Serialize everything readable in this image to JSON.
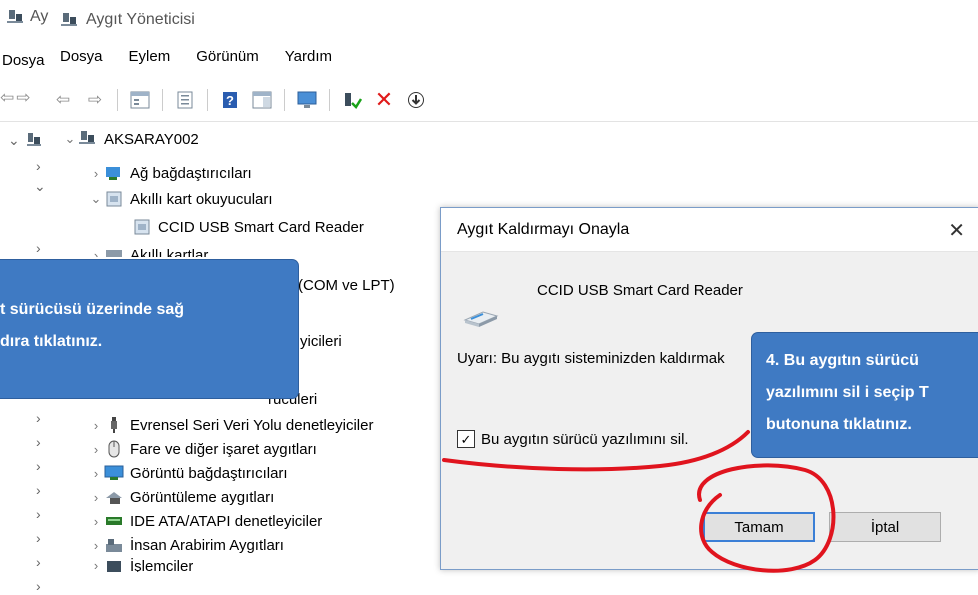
{
  "back_window": {
    "title_fragment": "Ay",
    "menu_fragment": "Dosya"
  },
  "window": {
    "title": "Aygıt Yöneticisi",
    "menu": [
      "Dosya",
      "Eylem",
      "Görünüm",
      "Yardım"
    ]
  },
  "tree": {
    "root": "AKSARAY002",
    "items": [
      "Ağ bağdaştırıcıları",
      "Akıllı kart okuyucuları",
      "CCID USB Smart Card Reader",
      "Akıllı kartlar",
      "(COM ve LPT)",
      "yicileri",
      "rücüleri",
      "Evrensel Seri Veri Yolu denetleyiciler",
      "Fare ve diğer işaret aygıtları",
      "Görüntü bağdaştırıcıları",
      "Görüntüleme aygıtları",
      "IDE ATA/ATAPI denetleyiciler",
      "İnsan Arabirim Aygıtları",
      "İşlemciler"
    ]
  },
  "dialog": {
    "title": "Aygıt Kaldırmayı Onayla",
    "device_name": "CCID USB Smart Card Reader",
    "warning": "Uyarı: Bu aygıtı sisteminizden kaldırmak",
    "checkbox_label": "Bu aygıtın sürücü yazılımını sil.",
    "checkbox_checked": true,
    "ok_label": "Tamam",
    "cancel_label": "İptal"
  },
  "callouts": {
    "left_line1": "t sürücüsü üzerinde sağ",
    "left_line2": "dıra tıklatınız.",
    "right_line1": "4. Bu aygıtın sürücü",
    "right_line2": "yazılımını sil i seçip T",
    "right_line3": "butonuna tıklatınız."
  },
  "colors": {
    "callout_bg": "#3f7ac3",
    "annotation_red": "#e0141e",
    "delete_red": "#e01a1a"
  },
  "icons": [
    "computer-icon",
    "back-arrow-icon",
    "forward-arrow-icon",
    "properties-icon",
    "help-icon",
    "monitor-icon",
    "enable-device-icon",
    "delete-icon",
    "download-arrow-icon",
    "usb-icon",
    "mouse-icon",
    "display-icon",
    "camera-icon",
    "ide-icon",
    "hid-icon"
  ]
}
